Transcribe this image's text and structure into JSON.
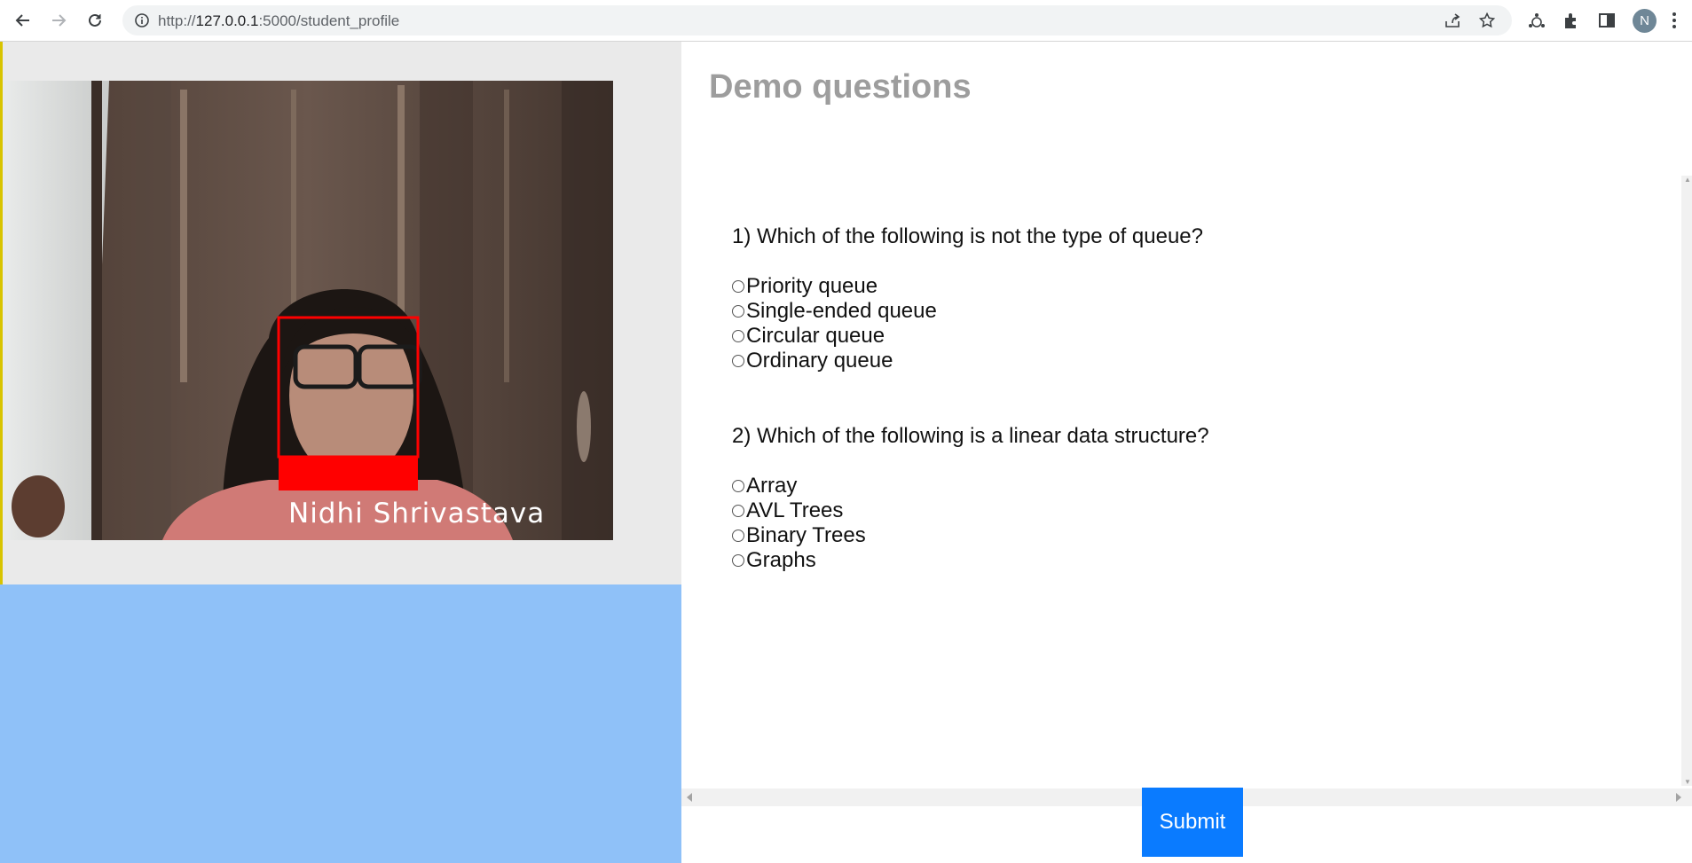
{
  "browser": {
    "url_prefix": "http://",
    "url_host": "127.0.0.1",
    "url_rest": ":5000/student_profile",
    "avatar_initial": "N"
  },
  "webcam": {
    "detected_name": "Nidhi Shrivastava",
    "box_color": "#ff0000"
  },
  "quiz": {
    "heading": "Demo questions",
    "questions": [
      {
        "text": "1) Which of the following is not the type of queue?",
        "options": [
          "Priority queue",
          "Single-ended queue",
          "Circular queue",
          "Ordinary queue"
        ]
      },
      {
        "text": "2) Which of the following is a linear data structure?",
        "options": [
          "Array",
          "AVL Trees",
          "Binary Trees",
          "Graphs"
        ]
      }
    ],
    "submit_label": "Submit"
  },
  "colors": {
    "left_top_bg": "#eaeaea",
    "left_bottom_bg": "#8fc1f8",
    "submit_bg": "#0a7bff",
    "heading_color": "#9d9d9d"
  }
}
